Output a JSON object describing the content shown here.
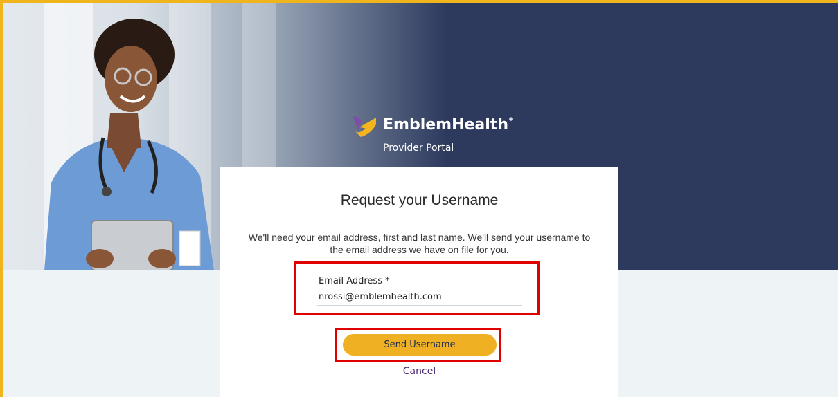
{
  "brand": {
    "name": "EmblemHealth",
    "registered_mark": "®",
    "subtitle": "Provider Portal",
    "logo_icon": "emblemhealth-logo-icon"
  },
  "form": {
    "title": "Request your Username",
    "description": "We'll need your email address, first and last name. We'll send your username to the email address we have on file for you.",
    "email_label": "Email Address *",
    "email_value": "nrossi@emblemhealth.com",
    "submit_label": "Send Username",
    "cancel_label": "Cancel"
  },
  "colors": {
    "hero_navy": "#2d3a5e",
    "accent_yellow": "#efb123",
    "highlight_red": "#e00000",
    "link_purple": "#4b2a70",
    "page_background": "#eef3f6"
  }
}
